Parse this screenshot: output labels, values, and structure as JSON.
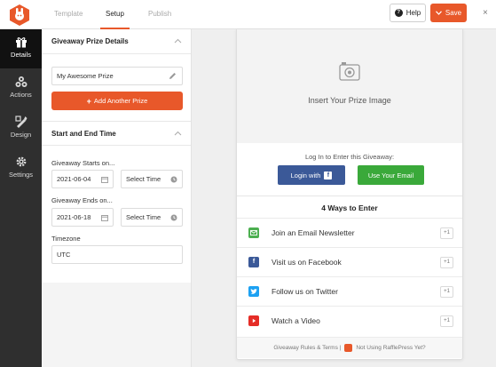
{
  "colors": {
    "accent": "#e8582a",
    "facebook": "#3b5998",
    "email_green": "#3aa93a",
    "twitter": "#1da1f2",
    "youtube": "#e52d27",
    "newsletter_green": "#4caf50"
  },
  "header": {
    "tabs": [
      {
        "label": "Template",
        "active": false
      },
      {
        "label": "Setup",
        "active": true
      },
      {
        "label": "Publish",
        "active": false
      }
    ],
    "help_label": "Help",
    "save_label": "Save",
    "close_glyph": "×"
  },
  "leftnav": {
    "items": [
      {
        "label": "Details",
        "icon": "gift-icon",
        "active": true
      },
      {
        "label": "Actions",
        "icon": "actions-icon",
        "active": false
      },
      {
        "label": "Design",
        "icon": "design-icon",
        "active": false
      },
      {
        "label": "Settings",
        "icon": "gear-icon",
        "active": false
      }
    ]
  },
  "panel": {
    "prize_section_title": "Giveaway Prize Details",
    "prize_value": "My Awesome Prize",
    "add_prize_label": "Add Another Prize",
    "time_section_title": "Start and End Time",
    "starts_label": "Giveaway Starts on...",
    "start_date": "2021-06-04",
    "start_time": "Select Time",
    "ends_label": "Giveaway Ends on...",
    "end_date": "2021-06-18",
    "end_time": "Select Time",
    "timezone_label": "Timezone",
    "timezone_value": "UTC"
  },
  "preview": {
    "image_placeholder": "Insert Your Prize Image",
    "login_prompt": "Log In to Enter this Giveaway:",
    "login_facebook": "Login with",
    "use_email": "Use Your Email",
    "ways_title": "4 Ways to Enter",
    "entries": [
      {
        "label": "Join an Email Newsletter",
        "points": "+1",
        "icon": "email-icon"
      },
      {
        "label": "Visit us on Facebook",
        "points": "+1",
        "icon": "facebook-icon"
      },
      {
        "label": "Follow us on Twitter",
        "points": "+1",
        "icon": "twitter-icon"
      },
      {
        "label": "Watch a Video",
        "points": "+1",
        "icon": "youtube-icon"
      }
    ],
    "footer_rules": "Giveaway Rules & Terms |",
    "footer_promo": "Not Using RafflePress Yet?"
  }
}
